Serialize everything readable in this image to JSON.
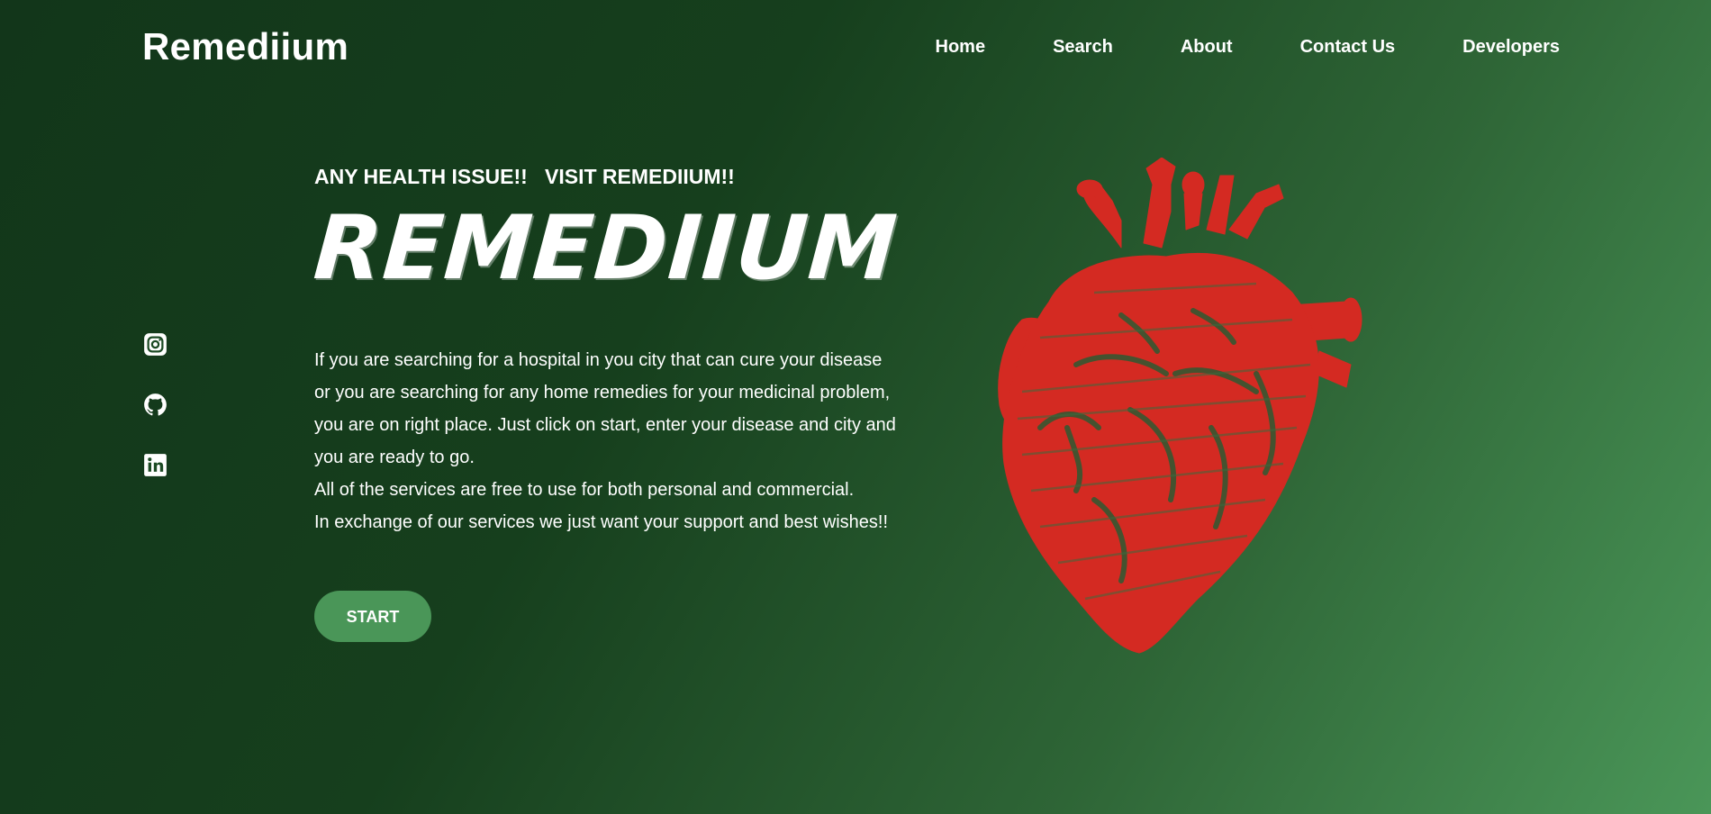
{
  "header": {
    "brand": "Remediium",
    "nav": [
      "Home",
      "Search",
      "About",
      "Contact Us",
      "Developers"
    ]
  },
  "social": {
    "icons": [
      "instagram-icon",
      "github-icon",
      "linkedin-icon"
    ]
  },
  "hero": {
    "tagline": "ANY HEALTH ISSUE!!   VISIT REMEDIIUM!!",
    "title": "REMEDIIUM",
    "description": [
      "If you are searching for a hospital in you city that can cure your disease",
      "or you are searching for any home remedies for your medicinal problem,",
      "you are on right place. Just click on start, enter your disease and city and",
      "you are ready to go.",
      "All of the services are free to use for both personal and commercial.",
      "In exchange of our services we just want your support and best wishes!!"
    ],
    "start_label": "START"
  },
  "colors": {
    "accent": "#4a9658",
    "heart": "#d42a22",
    "background_dark": "#12361a",
    "background_light": "#4a9658"
  }
}
